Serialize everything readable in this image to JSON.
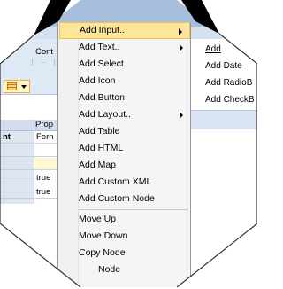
{
  "toolbar": {
    "container_label": "Cont"
  },
  "grid": {
    "header_label": "Prop",
    "rows": [
      {
        "left": "nt",
        "right": "Forn"
      },
      {
        "left": "",
        "right": ""
      },
      {
        "left": "",
        "right": ""
      },
      {
        "left": "",
        "right": "true"
      },
      {
        "left": "",
        "right": "true"
      }
    ]
  },
  "submenu": {
    "items": [
      "Add",
      "Add Date",
      "Add RadioB",
      "Add CheckB"
    ]
  },
  "context_menu": {
    "items": [
      {
        "label": "Add Input..",
        "submenu": true,
        "highlighted": true
      },
      {
        "label": "Add Text..",
        "submenu": true
      },
      {
        "label": "Add Select",
        "submenu": false
      },
      {
        "label": "Add Icon",
        "submenu": false
      },
      {
        "label": "Add Button",
        "submenu": false
      },
      {
        "label": "Add Layout..",
        "submenu": true
      },
      {
        "label": "Add Table",
        "submenu": false
      },
      {
        "label": "Add HTML",
        "submenu": false
      },
      {
        "label": "Add Map",
        "submenu": false
      },
      {
        "label": "Add Custom XML",
        "submenu": false
      },
      {
        "label": "Add Custom Node",
        "submenu": false
      },
      {
        "label": "Move Up",
        "submenu": false
      },
      {
        "label": "Move Down",
        "submenu": false
      },
      {
        "label": "Copy Node",
        "submenu": false
      },
      {
        "label": "Node",
        "submenu": false
      }
    ]
  },
  "colors": {
    "highlight": "#fde59a",
    "highlight_border": "#f2c24d",
    "menu_bg": "#f5f5f5",
    "toolbar_bg": "#dfe8f5",
    "frame_bg": "#ffffff",
    "frame_outline": "#000000"
  }
}
